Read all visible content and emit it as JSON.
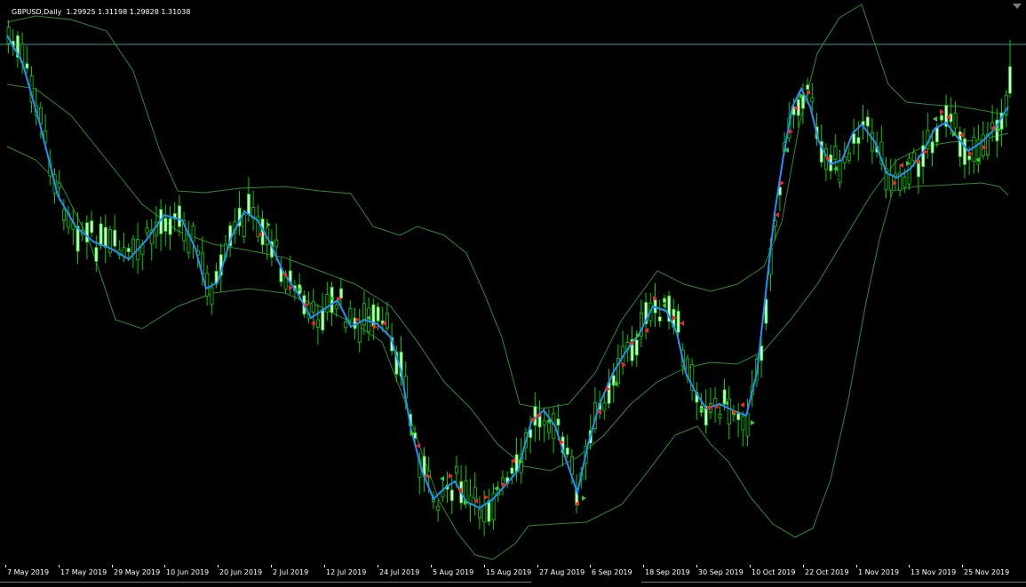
{
  "window": {
    "symbol_label": "GBPUSD,Daily  1.29925 1.31198 1.29828 1.31038"
  },
  "colors": {
    "background": "#000000",
    "candle_bull_body": "#ccffcc",
    "candle_bear_body": "#000000",
    "candle_wick": "#00d000",
    "ma_line": "#1e90ff",
    "band_line": "#2e8b2e",
    "current_price_line": "#3a9a9a",
    "arrow_sell": "#ff2020",
    "arrow_buy": "#33cc33",
    "axis_text": "#ffffff"
  },
  "time_axis": {
    "labels": [
      "7 May 2019",
      "17 May 2019",
      "29 May 2019",
      "10 Jun 2019",
      "20 Jun 2019",
      "2 Jul 2019",
      "12 Jul 2019",
      "24 Jul 2019",
      "5 Aug 2019",
      "15 Aug 2019",
      "27 Aug 2019",
      "6 Sep 2019",
      "18 Sep 2019",
      "30 Sep 2019",
      "10 Oct 2019",
      "22 Oct 2019",
      "1 Nov 2019",
      "13 Nov 2019",
      "25 Nov 2019"
    ]
  },
  "chart_data": {
    "type": "candlestick",
    "symbol": "GBPUSD",
    "timeframe": "Daily",
    "last_bar": {
      "open": 1.29925,
      "high": 1.31198,
      "low": 1.29828,
      "close": 1.31038
    },
    "indicators": [
      "moving average (blue)",
      "envelope / bands (green)",
      "signal arrows (red/green)"
    ],
    "x_dates": [
      "7 May 2019",
      "17 May 2019",
      "29 May 2019",
      "10 Jun 2019",
      "20 Jun 2019",
      "2 Jul 2019",
      "12 Jul 2019",
      "24 Jul 2019",
      "5 Aug 2019",
      "15 Aug 2019",
      "27 Aug 2019",
      "6 Sep 2019",
      "18 Sep 2019",
      "30 Sep 2019",
      "10 Oct 2019",
      "22 Oct 2019",
      "1 Nov 2019",
      "13 Nov 2019",
      "25 Nov 2019"
    ],
    "close_trend": [
      1.315,
      1.3,
      1.272,
      1.265,
      1.27,
      1.266,
      1.27,
      1.262,
      1.247,
      1.25,
      1.244,
      1.249,
      1.219,
      1.208,
      1.203,
      1.208,
      1.214,
      1.22,
      1.21,
      1.23,
      1.24,
      1.25,
      1.245,
      1.23,
      1.226,
      1.228,
      1.273,
      1.294,
      1.282,
      1.292,
      1.283,
      1.286,
      1.29,
      1.295,
      1.293,
      1.301,
      1.31
    ]
  }
}
